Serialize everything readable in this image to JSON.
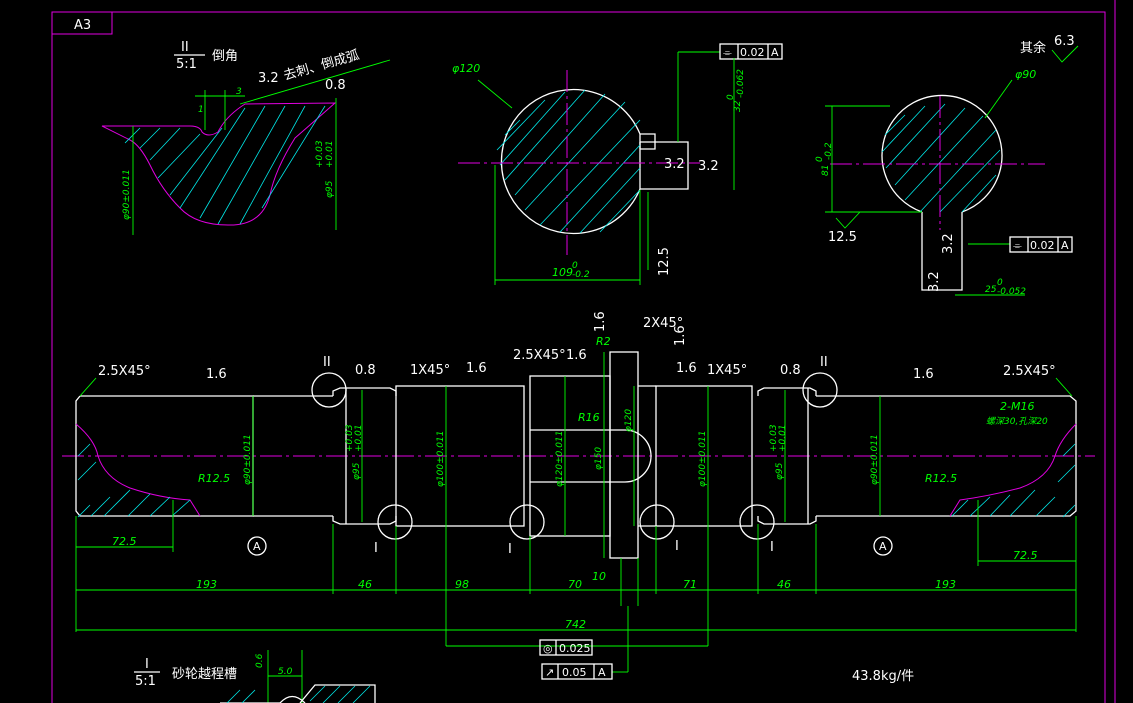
{
  "sheet": {
    "size_label": "A3"
  },
  "details": {
    "ii": {
      "roman": "II",
      "scale": "5:1",
      "title": "倒角",
      "dim_3": "3",
      "dim_1": "1",
      "r1": "3.2",
      "r1_note": "去刺、倒成弧",
      "r2": "0.8",
      "d90": "φ90±0.011",
      "d95": "φ95",
      "d95_tol_u": "+0.03",
      "d95_tol_l": "+0.01"
    },
    "i": {
      "roman": "I",
      "scale": "5:1",
      "title": "砂轮越程槽",
      "dim_06": "0.6",
      "dim_50": "5.0"
    }
  },
  "sections": {
    "left": {
      "dia": "φ120",
      "r_key1": "3.2",
      "r_key2": "3.2",
      "r_bottom": "12.5",
      "width": "109",
      "width_tol_u": "0",
      "width_tol_l": "-0.2",
      "key_w": "32",
      "key_w_tol_u": "0",
      "key_w_tol_l": "-0.062",
      "tol_frame": {
        "sym": "⌯",
        "val": "0.02",
        "datum": "A"
      }
    },
    "right": {
      "dia": "φ90",
      "depth": "81",
      "depth_tol_u": "0",
      "depth_tol_l": "-0.2",
      "r_left": "12.5",
      "r_key1": "3.2",
      "r_key2": "3.2",
      "key_w": "25",
      "key_w_tol_u": "0",
      "key_w_tol_l": "-0.052",
      "tol_frame": {
        "sym": "⌯",
        "val": "0.02",
        "datum": "A"
      }
    }
  },
  "roughness": {
    "rest_label": "其余",
    "rest_value": "6.3"
  },
  "shaft": {
    "chamfer_l": "2.5X45°",
    "chamfer_r": "2.5X45°",
    "chamfer_c": "2.5X45°",
    "chamfer_c2": "2X45°",
    "chamfer_1a": "1X45°",
    "chamfer_1b": "1X45°",
    "ra_16a": "1.6",
    "ra_16b": "1.6",
    "ra_16c": "1.6",
    "ra_16d": "1.6",
    "ra_16e": "1.6",
    "ra_16f": "1.6",
    "ra_16g": "1.6",
    "ra_08a": "0.8",
    "ra_08b": "0.8",
    "det_ii_a": "II",
    "det_ii_b": "II",
    "det_i_a": "I",
    "det_i_b": "I",
    "det_i_c": "I",
    "det_i_d": "I",
    "r2": "R2",
    "r16": "R16",
    "r125a": "R12.5",
    "r125b": "R12.5",
    "d90a": "φ90±0.011",
    "d95a": "φ95",
    "d100a": "φ100±0.011",
    "d120a": "φ120±0.011",
    "d150": "φ150",
    "d120b": "φ120",
    "d100b": "φ100±0.011",
    "d95b": "φ95",
    "d90b": "φ90±0.011",
    "tol95_u": "+0.03",
    "tol95_l": "+0.01",
    "thread": "2-M16",
    "thread_depth": "螺深30,孔深20",
    "datum_a": "A",
    "datum_b": "A",
    "dim_725a": "72.5",
    "dim_725b": "72.5",
    "dim_193a": "193",
    "dim_46a": "46",
    "dim_98": "98",
    "dim_70": "70",
    "dim_10": "10",
    "dim_71": "71",
    "dim_46b": "46",
    "dim_193b": "193",
    "dim_742": "742",
    "runout1": {
      "sym": "◎",
      "val": "0.025"
    },
    "runout2": {
      "sym": "↗",
      "val": "0.05",
      "datum": "A"
    }
  },
  "weight": "43.8kg/件"
}
